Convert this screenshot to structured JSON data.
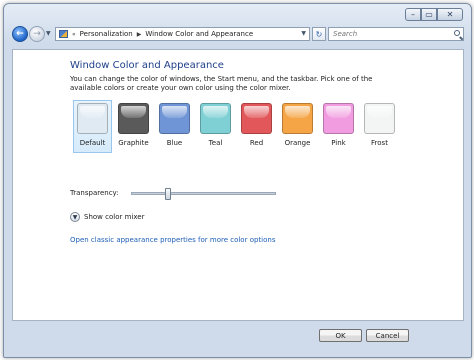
{
  "toolbar": {
    "breadcrumb_prefix": "«",
    "crumbs": [
      "Personalization",
      "Window Color and Appearance"
    ],
    "search_placeholder": "Search"
  },
  "main": {
    "title": "Window Color and Appearance",
    "description": "You can change the color of windows, the Start menu, and the taskbar. Pick one of the available colors or create your own color using the color mixer.",
    "swatches": [
      {
        "label": "Default",
        "color": "#dfeaf3",
        "selected": true
      },
      {
        "label": "Graphite",
        "color": "#5a5a5a",
        "selected": false
      },
      {
        "label": "Blue",
        "color": "#6f95d6",
        "selected": false
      },
      {
        "label": "Teal",
        "color": "#7fd0d4",
        "selected": false
      },
      {
        "label": "Red",
        "color": "#e2575a",
        "selected": false
      },
      {
        "label": "Orange",
        "color": "#f5a545",
        "selected": false
      },
      {
        "label": "Pink",
        "color": "#f19ce0",
        "selected": false
      },
      {
        "label": "Frost",
        "color": "#f2f5f4",
        "selected": false
      }
    ],
    "transparency_label": "Transparency:",
    "transparency_level": 0.24,
    "show_color_mixer": "Show color mixer",
    "classic_link": "Open classic appearance properties for more color options"
  },
  "footer": {
    "ok_label": "OK",
    "cancel_label": "Cancel"
  }
}
